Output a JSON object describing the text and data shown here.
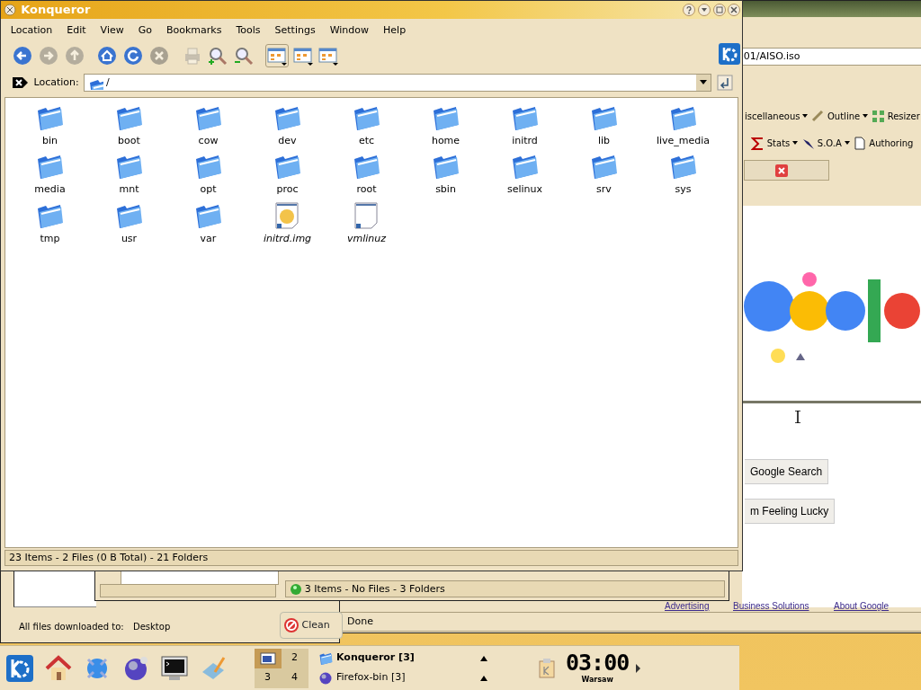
{
  "firefox": {
    "url": "01/AISO.iso",
    "toolbar1": [
      "iscellaneous",
      "Outline",
      "Resizer"
    ],
    "toolbar2": [
      "Stats",
      "S.O.A",
      "Authoring"
    ],
    "buttons": [
      "Google Search",
      "m Feeling Lucky"
    ],
    "footer_links": [
      "Advertising",
      "Business Solutions",
      "About Google"
    ],
    "status": "Done"
  },
  "back_window": {
    "status": "3 Items - No Files - 3 Folders"
  },
  "downloads": {
    "label": "All files downloaded to:",
    "folder": "Desktop",
    "clean_button": "Clean"
  },
  "konqueror": {
    "title": "Konqueror",
    "menu": [
      "Location",
      "Edit",
      "View",
      "Go",
      "Bookmarks",
      "Tools",
      "Settings",
      "Window",
      "Help"
    ],
    "toolbar": [
      {
        "kind": "back",
        "disabled": false
      },
      {
        "kind": "forward",
        "disabled": true
      },
      {
        "kind": "up",
        "disabled": true
      },
      {
        "kind": "home",
        "disabled": false
      },
      {
        "kind": "reload",
        "disabled": false
      },
      {
        "kind": "stop",
        "disabled": true
      },
      {
        "kind": "print",
        "disabled": true
      },
      {
        "kind": "zoom-in",
        "disabled": false
      },
      {
        "kind": "zoom-out",
        "disabled": false
      },
      {
        "kind": "view",
        "selected": true
      },
      {
        "kind": "view",
        "selected": false
      },
      {
        "kind": "view",
        "selected": false
      }
    ],
    "location_label": "Location:",
    "location_value": "/",
    "files": [
      {
        "name": "bin",
        "kind": "folder"
      },
      {
        "name": "boot",
        "kind": "folder"
      },
      {
        "name": "cow",
        "kind": "folder"
      },
      {
        "name": "dev",
        "kind": "folder"
      },
      {
        "name": "etc",
        "kind": "folder"
      },
      {
        "name": "home",
        "kind": "folder"
      },
      {
        "name": "initrd",
        "kind": "folder"
      },
      {
        "name": "lib",
        "kind": "folder"
      },
      {
        "name": "live_media",
        "kind": "folder"
      },
      {
        "name": "media",
        "kind": "folder"
      },
      {
        "name": "mnt",
        "kind": "folder"
      },
      {
        "name": "opt",
        "kind": "folder"
      },
      {
        "name": "proc",
        "kind": "folder"
      },
      {
        "name": "root",
        "kind": "folder"
      },
      {
        "name": "sbin",
        "kind": "folder"
      },
      {
        "name": "selinux",
        "kind": "folder"
      },
      {
        "name": "srv",
        "kind": "folder"
      },
      {
        "name": "sys",
        "kind": "folder"
      },
      {
        "name": "tmp",
        "kind": "folder"
      },
      {
        "name": "usr",
        "kind": "folder"
      },
      {
        "name": "var",
        "kind": "folder"
      },
      {
        "name": "initrd.img",
        "kind": "image-file"
      },
      {
        "name": "vmlinuz",
        "kind": "file"
      }
    ],
    "status": "23 Items - 2 Files (0 B Total) - 21 Folders"
  },
  "taskbar": {
    "pager": [
      {
        "selected": true
      },
      {
        "label": "2",
        "selected": false
      },
      {
        "label": "3",
        "selected": false
      },
      {
        "label": "4",
        "selected": false
      }
    ],
    "tasks": [
      {
        "label": "Konqueror [3]",
        "active": true
      },
      {
        "label": "Firefox-bin [3]",
        "active": false
      }
    ],
    "clock": "03:00",
    "timezone": "Warsaw"
  }
}
